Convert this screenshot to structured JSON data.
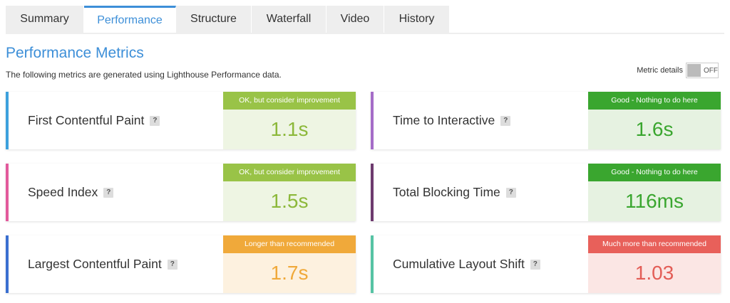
{
  "tabs": [
    {
      "label": "Summary",
      "active": false
    },
    {
      "label": "Performance",
      "active": true
    },
    {
      "label": "Structure",
      "active": false
    },
    {
      "label": "Waterfall",
      "active": false
    },
    {
      "label": "Video",
      "active": false
    },
    {
      "label": "History",
      "active": false
    }
  ],
  "header": {
    "title": "Performance Metrics",
    "subtitle": "The following metrics are generated using Lighthouse Performance data."
  },
  "toggle": {
    "label": "Metric details",
    "state": "OFF"
  },
  "help_glyph": "?",
  "metrics": [
    {
      "name": "First Contentful Paint",
      "grade": "OK, but consider improvement",
      "value": "1.1s",
      "accent": "#3da1dd",
      "grade_bg": "#99c347",
      "value_bg": "#eef5e3",
      "value_color": "#8cb83a"
    },
    {
      "name": "Time to Interactive",
      "grade": "Good - Nothing to do here",
      "value": "1.6s",
      "accent": "#a56cc8",
      "grade_bg": "#3aa62f",
      "value_bg": "#e6f2e1",
      "value_color": "#3aa62f"
    },
    {
      "name": "Speed Index",
      "grade": "OK, but consider improvement",
      "value": "1.5s",
      "accent": "#e25a9c",
      "grade_bg": "#99c347",
      "value_bg": "#eef5e3",
      "value_color": "#8cb83a"
    },
    {
      "name": "Total Blocking Time",
      "grade": "Good - Nothing to do here",
      "value": "116ms",
      "accent": "#6d3a6e",
      "grade_bg": "#3aa62f",
      "value_bg": "#e6f2e1",
      "value_color": "#3aa62f"
    },
    {
      "name": "Largest Contentful Paint",
      "grade": "Longer than recommended",
      "value": "1.7s",
      "accent": "#3a6fd0",
      "grade_bg": "#f0a93a",
      "value_bg": "#fdf1df",
      "value_color": "#f0a93a"
    },
    {
      "name": "Cumulative Layout Shift",
      "grade": "Much more than recommended",
      "value": "1.03",
      "accent": "#56c3a4",
      "grade_bg": "#e8605a",
      "value_bg": "#fbe6e4",
      "value_color": "#e35d56"
    }
  ]
}
